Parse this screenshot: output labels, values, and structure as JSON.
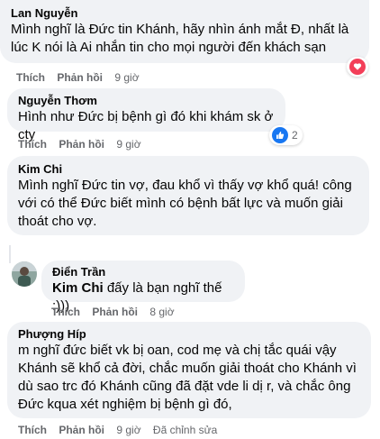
{
  "comments": [
    {
      "author": "Lan Nguyễn",
      "lines": [
        "Mình nghĩ là Đức tin Khánh, hãy nhìn ánh mắt Đ, nhất là",
        "lúc K nói là Ai nhắn tin cho mọi người đến khách sạn"
      ],
      "actions": {
        "like": "Thích",
        "reply": "Phản hồi",
        "time": "9 giờ"
      },
      "reaction": {
        "icon": "heart-icon",
        "color": "#f33e58"
      }
    },
    {
      "author": "Nguyễn Thơm",
      "lines": [
        "Hình như Đức bị bệnh gì đó khi khám sk ở cty"
      ],
      "actions": {
        "like": "Thích",
        "reply": "Phản hồi",
        "time": "9 giờ"
      },
      "reaction": {
        "icon": "like-icon",
        "color": "#1877f2",
        "count": "2"
      }
    },
    {
      "author": "Kim Chi",
      "lines": [
        "Mình nghĩ Đức tin vợ, đau khổ vì thấy vợ khổ quá! công",
        "với có thể Đức biết mình có bệnh bất lực và muốn giải",
        "thoát cho vợ."
      ],
      "actions": {
        "like": "Thích",
        "reply": "Phản hồi",
        "time": "9 giờ"
      }
    },
    {
      "author": "Điển Trần",
      "mention": "Kim Chi",
      "text": " đấy là bạn nghĩ thế :)))",
      "actions": {
        "like": "Thích",
        "reply": "Phản hồi",
        "time": "8 giờ"
      }
    },
    {
      "author": "Phượng Híp",
      "lines": [
        "m nghĩ đức biết vk bị oan, cod mẹ và chị tắc quái vậy",
        "Khánh sẽ khổ cả đời, chắc muốn giải thoát cho Khánh vì",
        "dù sao trc đó Khánh cũng đã đặt vde li dị r, và chắc ông",
        "Đức kqua xét nghiệm bị bệnh gì đó,"
      ],
      "actions": {
        "like": "Thích",
        "reply": "Phản hồi",
        "time": "9 giờ",
        "edited": "Đã chỉnh sửa"
      }
    }
  ]
}
